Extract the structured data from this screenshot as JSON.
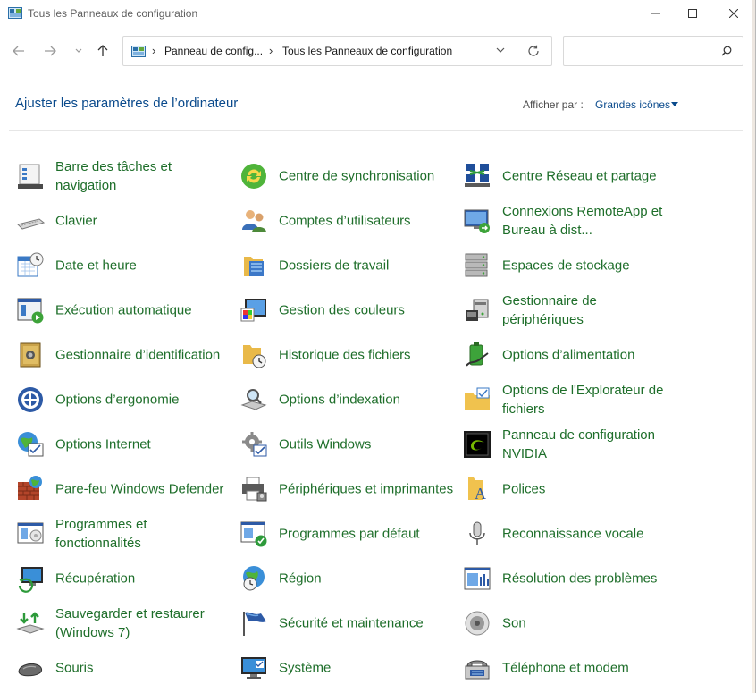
{
  "window": {
    "title": "Tous les Panneaux de configuration"
  },
  "address": {
    "crumbs": [
      "Panneau de config...",
      "Tous les Panneaux de configuration"
    ],
    "search_placeholder": ""
  },
  "header": {
    "title": "Ajuster les paramètres de l’ordinateur",
    "view_label": "Afficher par :",
    "view_value": "Grandes icônes"
  },
  "items": [
    {
      "label": "Barre des tâches et navigation",
      "icon": "taskbar-icon"
    },
    {
      "label": "Centre de synchronisation",
      "icon": "sync-center-icon"
    },
    {
      "label": "Centre Réseau et partage",
      "icon": "network-icon"
    },
    {
      "label": "Clavier",
      "icon": "keyboard-icon"
    },
    {
      "label": "Comptes d’utilisateurs",
      "icon": "users-icon"
    },
    {
      "label": "Connexions RemoteApp et Bureau à dist...",
      "icon": "remoteapp-icon"
    },
    {
      "label": "Date et heure",
      "icon": "calendar-clock-icon"
    },
    {
      "label": "Dossiers de travail",
      "icon": "work-folders-icon"
    },
    {
      "label": "Espaces de stockage",
      "icon": "storage-spaces-icon"
    },
    {
      "label": "Exécution automatique",
      "icon": "autoplay-icon"
    },
    {
      "label": "Gestion des couleurs",
      "icon": "color-management-icon"
    },
    {
      "label": "Gestionnaire de périphériques",
      "icon": "device-manager-icon"
    },
    {
      "label": "Gestionnaire d’identification",
      "icon": "credential-manager-icon"
    },
    {
      "label": "Historique des fichiers",
      "icon": "file-history-icon"
    },
    {
      "label": "Options d’alimentation",
      "icon": "power-options-icon"
    },
    {
      "label": "Options d’ergonomie",
      "icon": "ease-of-access-icon"
    },
    {
      "label": "Options d’indexation",
      "icon": "indexing-icon"
    },
    {
      "label": "Options de l'Explorateur de fichiers",
      "icon": "explorer-options-icon"
    },
    {
      "label": "Options Internet",
      "icon": "internet-options-icon"
    },
    {
      "label": "Outils Windows",
      "icon": "windows-tools-icon"
    },
    {
      "label": "Panneau de configuration NVIDIA",
      "icon": "nvidia-icon"
    },
    {
      "label": "Pare-feu Windows Defender",
      "icon": "firewall-icon"
    },
    {
      "label": "Périphériques et imprimantes",
      "icon": "printer-icon"
    },
    {
      "label": "Polices",
      "icon": "fonts-icon"
    },
    {
      "label": "Programmes et fonctionnalités",
      "icon": "programs-icon"
    },
    {
      "label": "Programmes par défaut",
      "icon": "default-programs-icon"
    },
    {
      "label": "Reconnaissance vocale",
      "icon": "microphone-icon"
    },
    {
      "label": "Récupération",
      "icon": "recovery-icon"
    },
    {
      "label": "Région",
      "icon": "region-icon"
    },
    {
      "label": "Résolution des problèmes",
      "icon": "troubleshoot-icon"
    },
    {
      "label": "Sauvegarder et restaurer (Windows 7)",
      "icon": "backup-icon"
    },
    {
      "label": "Sécurité et maintenance",
      "icon": "security-flag-icon"
    },
    {
      "label": "Son",
      "icon": "speaker-icon"
    },
    {
      "label": "Souris",
      "icon": "mouse-icon"
    },
    {
      "label": "Système",
      "icon": "system-icon"
    },
    {
      "label": "Téléphone et modem",
      "icon": "phone-modem-icon"
    }
  ]
}
